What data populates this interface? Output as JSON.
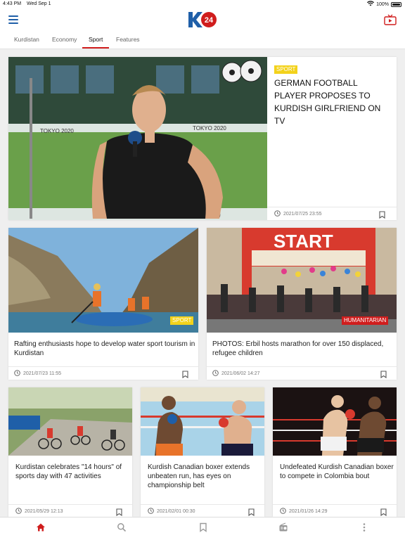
{
  "status": {
    "time": "4:43 PM",
    "date": "Wed Sep 1",
    "battery": "100%"
  },
  "tabs": [
    {
      "label": "Kurdistan"
    },
    {
      "label": "Economy"
    },
    {
      "label": "Sport"
    },
    {
      "label": "Features"
    }
  ],
  "active_tab": "Sport",
  "colors": {
    "accent": "#d01d1d",
    "brand_blue": "#1f5fa8",
    "sport_label": "#f3d21b"
  },
  "featured": {
    "label": "SPORT",
    "title": "GERMAN FOOTBALL PLAYER PROPOSES TO KURDISH GIRLFRIEND ON TV",
    "date": "2021/07/25 23:55",
    "image_caption": "TOKYO 2020"
  },
  "row2": [
    {
      "label": "SPORT",
      "title": "Rafting enthusiasts hope to develop water sport tourism in Kurdistan",
      "date": "2021/07/23 11:55"
    },
    {
      "label": "HUMANITARIAN",
      "title": "PHOTOS: Erbil hosts marathon for over 150 displaced, refugee children",
      "date": "2021/06/02 14:27",
      "image_caption": "START"
    }
  ],
  "row3": [
    {
      "title": "Kurdistan celebrates \"14 hours\" of sports day with 47 activities",
      "date": "2021/05/29 12:13"
    },
    {
      "title": "Kurdish Canadian boxer extends unbeaten run, has eyes on championship belt",
      "date": "2021/02/01 00:30"
    },
    {
      "title": "Undefeated Kurdish Canadian boxer to compete in Colombia bout",
      "date": "2021/01/26 14:29"
    }
  ],
  "bottom_nav": [
    "home-icon",
    "search-icon",
    "bookmark-icon",
    "radio-icon",
    "more-icon"
  ]
}
